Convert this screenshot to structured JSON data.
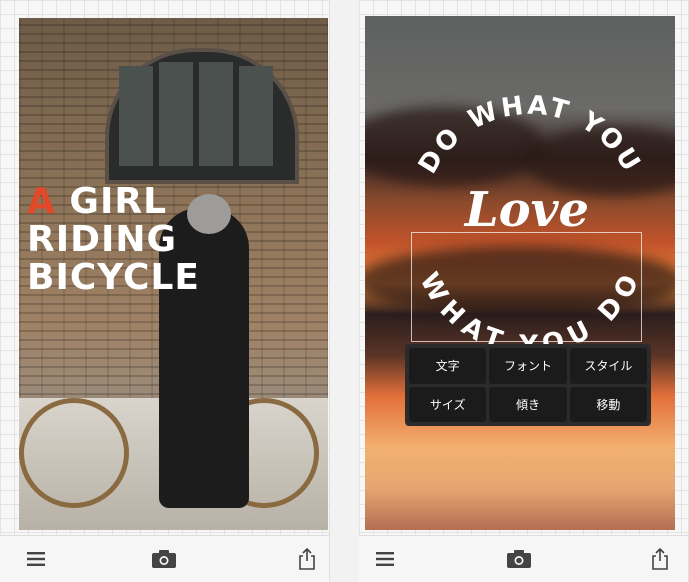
{
  "left": {
    "poster": {
      "line1_a": "A",
      "line1_rest": "GIRL",
      "line2": "RIDING",
      "line3": "BICYCLE"
    }
  },
  "right": {
    "circular_top": "DO WHAT YOU",
    "center": "Love",
    "circular_bottom": "WHAT YOU DO",
    "menu": [
      "文字",
      "フォント",
      "スタイル",
      "サイズ",
      "傾き",
      "移動"
    ]
  },
  "toolbar": {
    "icons": [
      "menu-icon",
      "camera-icon",
      "share-icon"
    ]
  },
  "colors": {
    "accent": "#e04a2a",
    "toolbar_bg": "#f6f6f6",
    "menu_bg": "#1b1b1b"
  }
}
